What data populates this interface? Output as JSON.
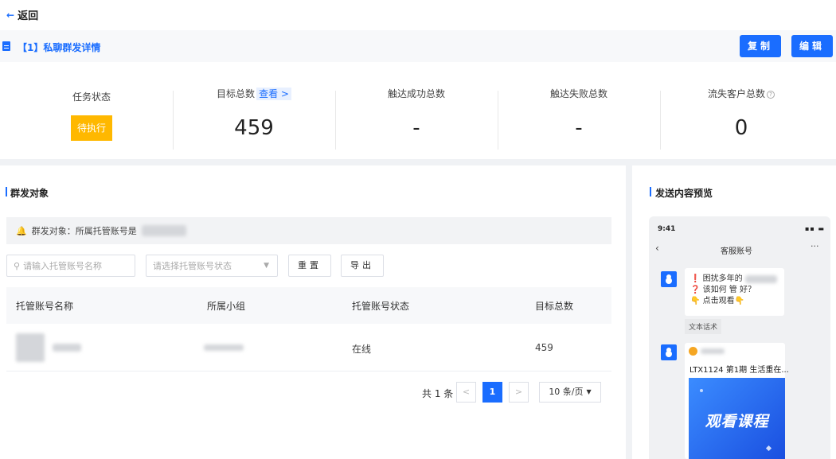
{
  "header": {
    "back_label": "返回",
    "title": "【1】私聊群发详情",
    "copy_label": "复制",
    "edit_label": "编辑"
  },
  "stats": {
    "task_status_label": "任务状态",
    "task_status_value": "待执行",
    "target_total_label": "目标总数",
    "view_link": "查看 >",
    "target_total_value": "459",
    "reach_success_label": "触达成功总数",
    "reach_success_value": "-",
    "reach_fail_label": "触达失败总数",
    "reach_fail_value": "-",
    "lost_customers_label": "流失客户总数",
    "lost_customers_value": "0"
  },
  "targets": {
    "section_title": "群发对象",
    "notice_text": "群发对象：所属托管账号是",
    "search_placeholder": "请输入托管账号名称",
    "status_placeholder": "请选择托管账号状态",
    "reset_label": "重置",
    "export_label": "导出",
    "columns": [
      "托管账号名称",
      "所属小组",
      "托管账号状态",
      "目标总数"
    ],
    "rows": [
      {
        "status": "在线",
        "target_total": "459"
      }
    ],
    "pagination": {
      "total_text": "共 1 条",
      "current_page": "1",
      "page_size": "10 条/页"
    }
  },
  "preview": {
    "section_title": "发送内容预览",
    "time": "9:41",
    "chat_title": "客服账号",
    "message1": {
      "line1": "❗ 困扰多年的",
      "line2": "❓ 该如何 管 好？",
      "line3": "👇 点击观看👇"
    },
    "tag_label": "文本话术",
    "message2_title": "LTX1124 第1期 生活重在...",
    "banner_text": "观看课程"
  },
  "colors": {
    "accent": "#1a6dff",
    "warning": "#ffb800"
  }
}
